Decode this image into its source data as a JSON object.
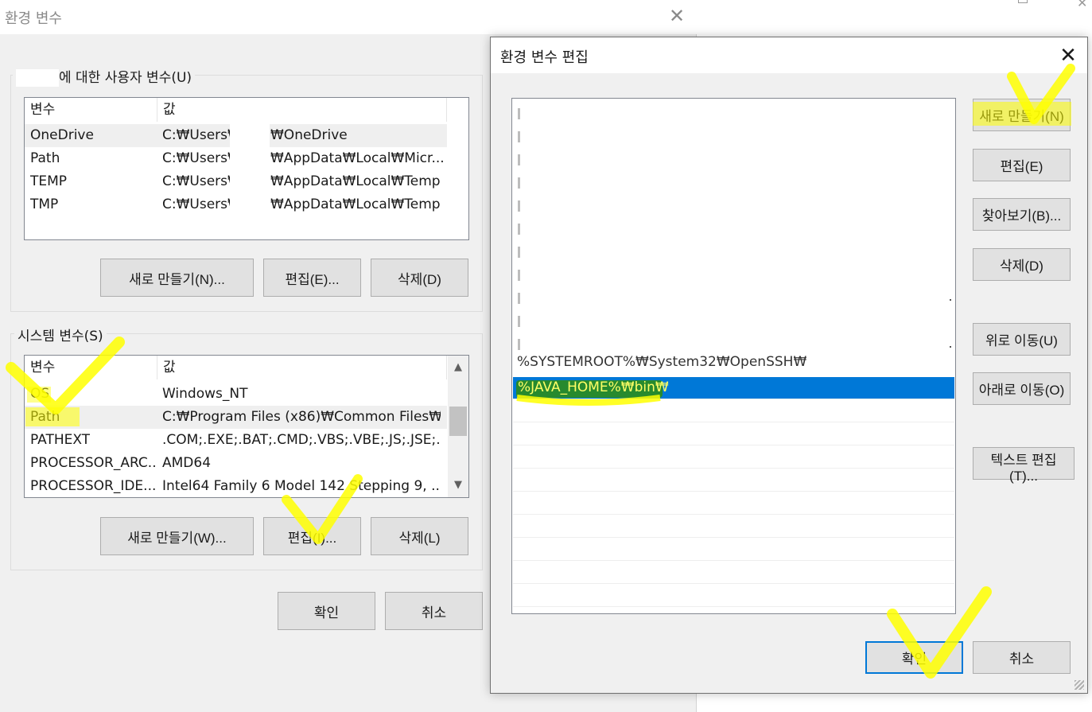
{
  "env_dialog": {
    "title": "환경 변수",
    "user_vars": {
      "group_label": "에 대한 사용자 변수(U)",
      "columns": [
        "변수",
        "값"
      ],
      "rows": [
        {
          "name": "OneDrive",
          "value_prefix": "C:₩Users₩",
          "value_suffix": "₩OneDrive"
        },
        {
          "name": "Path",
          "value_prefix": "C:₩Users₩",
          "value_suffix": "₩AppData₩Local₩Micr..."
        },
        {
          "name": "TEMP",
          "value_prefix": "C:₩Users₩",
          "value_suffix": "₩AppData₩Local₩Temp"
        },
        {
          "name": "TMP",
          "value_prefix": "C:₩Users₩",
          "value_suffix": "₩AppData₩Local₩Temp"
        }
      ],
      "buttons": {
        "new": "새로 만들기(N)...",
        "edit": "편집(E)...",
        "delete": "삭제(D)"
      }
    },
    "system_vars": {
      "group_label": "시스템 변수(S)",
      "columns": [
        "변수",
        "값"
      ],
      "rows": [
        {
          "name": "OS",
          "value": "Windows_NT"
        },
        {
          "name": "Path",
          "value": "C:₩Program Files (x86)₩Common Files₩..."
        },
        {
          "name": "PATHEXT",
          "value": ".COM;.EXE;.BAT;.CMD;.VBS;.VBE;.JS;.JSE;.W..."
        },
        {
          "name": "PROCESSOR_ARC...",
          "value": "AMD64"
        },
        {
          "name": "PROCESSOR_IDE...",
          "value": "Intel64 Family 6 Model 142 Stepping 9, ..."
        }
      ],
      "buttons": {
        "new": "새로 만들기(W)...",
        "edit": "편집(I)...",
        "delete": "삭제(L)"
      }
    },
    "ok": "확인",
    "cancel": "취소"
  },
  "edit_dialog": {
    "title": "환경 변수 편집",
    "partial_entry": "%SYSTEMROOT%₩System32₩OpenSSH₩",
    "selected_entry": "%JAVA_HOME%₩bin₩",
    "buttons": {
      "new": "새로 만들기(N)",
      "edit": "편집(E)",
      "browse": "찾아보기(B)...",
      "delete": "삭제(D)",
      "move_up": "위로 이동(U)",
      "move_down": "아래로 이동(O)",
      "edit_text": "텍스트 편집(T)..."
    },
    "ok": "확인",
    "cancel": "취소"
  },
  "colors": {
    "selection": "#0078d7",
    "highlighter": "#ffff00",
    "dialog_bg": "#f0f0f0"
  }
}
